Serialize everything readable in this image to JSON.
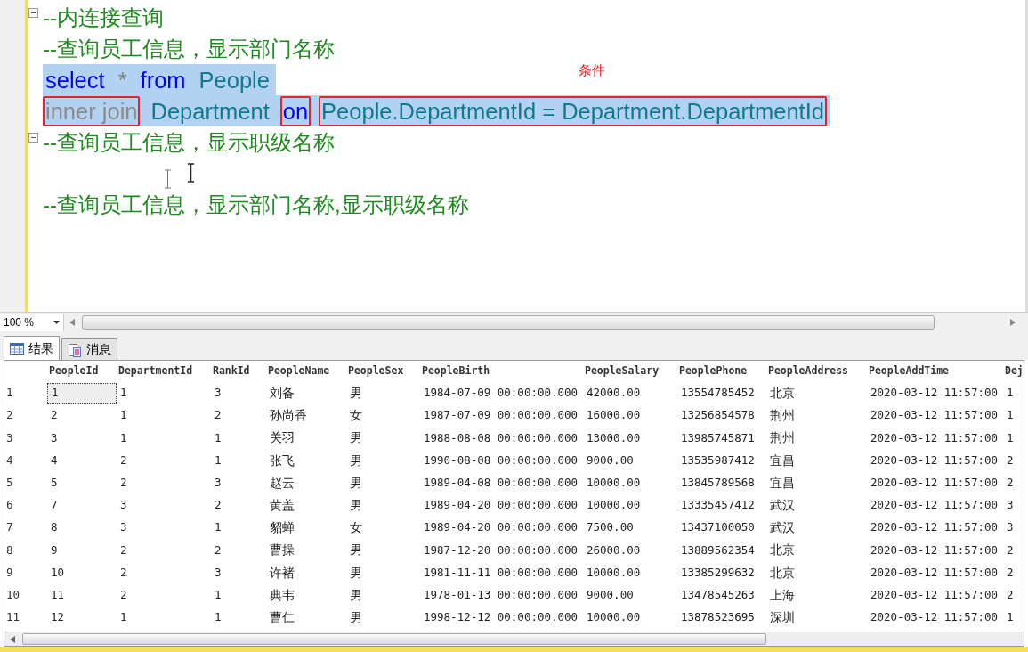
{
  "editor": {
    "lines": [
      {
        "kind": "comment",
        "collapsible": true,
        "selected": false,
        "text": "--内连接查询"
      },
      {
        "kind": "comment",
        "collapsible": false,
        "selected": false,
        "text": "--查询员工信息，显示部门名称"
      },
      {
        "kind": "code",
        "collapsible": false,
        "selected": true,
        "tokens": [
          {
            "kind": "keyword",
            "text": "select",
            "boxed": false
          },
          {
            "kind": "operator",
            "text": "*",
            "boxed": false
          },
          {
            "kind": "keyword",
            "text": "from",
            "boxed": false
          },
          {
            "kind": "identifier",
            "text": "People",
            "boxed": false
          }
        ]
      },
      {
        "kind": "code",
        "collapsible": false,
        "selected": true,
        "tokens": [
          {
            "kind": "join",
            "text": "inner join",
            "boxed": true
          },
          {
            "kind": "identifier",
            "text": "Department",
            "boxed": false
          },
          {
            "kind": "keyword",
            "text": "on",
            "boxed": true
          },
          {
            "kind": "identifier",
            "text": "People.DepartmentId = Department.DepartmentId",
            "boxed": true
          }
        ]
      },
      {
        "kind": "comment",
        "collapsible": true,
        "selected": false,
        "text": "--查询员工信息，显示职级名称"
      },
      {
        "kind": "blank"
      },
      {
        "kind": "comment",
        "collapsible": false,
        "selected": false,
        "text": "--查询员工信息，显示部门名称,显示职级名称"
      }
    ],
    "annotation": "条件"
  },
  "zoom": {
    "value": "100 %"
  },
  "tabs": [
    {
      "label": "结果",
      "selected": true
    },
    {
      "label": "消息",
      "selected": false
    }
  ],
  "grid": {
    "columns": [
      "PeopleId",
      "DepartmentId",
      "RankId",
      "PeopleName",
      "PeopleSex",
      "PeopleBirth",
      "PeopleSalary",
      "PeoplePhone",
      "PeopleAddress",
      "PeopleAddTime",
      "Dej"
    ],
    "rows": [
      {
        "num": "1",
        "selected": true,
        "cells": [
          "1",
          "1",
          "3",
          "刘备",
          "男",
          "1984-07-09 00:00:00.000",
          "42000.00",
          "13554785452",
          "北京",
          "2020-03-12 11:57:00",
          "1"
        ]
      },
      {
        "num": "2",
        "selected": false,
        "cells": [
          "2",
          "1",
          "2",
          "孙尚香",
          "女",
          "1987-07-09 00:00:00.000",
          "16000.00",
          "13256854578",
          "荆州",
          "2020-03-12 11:57:00",
          "1"
        ]
      },
      {
        "num": "3",
        "selected": false,
        "cells": [
          "3",
          "1",
          "1",
          "关羽",
          "男",
          "1988-08-08 00:00:00.000",
          "13000.00",
          "13985745871",
          "荆州",
          "2020-03-12 11:57:00",
          "1"
        ]
      },
      {
        "num": "4",
        "selected": false,
        "cells": [
          "4",
          "2",
          "1",
          "张飞",
          "男",
          "1990-08-08 00:00:00.000",
          "9000.00",
          "13535987412",
          "宜昌",
          "2020-03-12 11:57:00",
          "2"
        ]
      },
      {
        "num": "5",
        "selected": false,
        "cells": [
          "5",
          "2",
          "3",
          "赵云",
          "男",
          "1989-04-08 00:00:00.000",
          "10000.00",
          "13845789568",
          "宜昌",
          "2020-03-12 11:57:00",
          "2"
        ]
      },
      {
        "num": "6",
        "selected": false,
        "cells": [
          "7",
          "3",
          "2",
          "黄盖",
          "男",
          "1989-04-20 00:00:00.000",
          "10000.00",
          "13335457412",
          "武汉",
          "2020-03-12 11:57:00",
          "3"
        ]
      },
      {
        "num": "7",
        "selected": false,
        "cells": [
          "8",
          "3",
          "1",
          "貂蝉",
          "女",
          "1989-04-20 00:00:00.000",
          "7500.00",
          "13437100050",
          "武汉",
          "2020-03-12 11:57:00",
          "3"
        ]
      },
      {
        "num": "8",
        "selected": false,
        "cells": [
          "9",
          "2",
          "2",
          "曹操",
          "男",
          "1987-12-20 00:00:00.000",
          "26000.00",
          "13889562354",
          "北京",
          "2020-03-12 11:57:00",
          "2"
        ]
      },
      {
        "num": "9",
        "selected": false,
        "cells": [
          "10",
          "2",
          "3",
          "许褚",
          "男",
          "1981-11-11 00:00:00.000",
          "10000.00",
          "13385299632",
          "北京",
          "2020-03-12 11:57:00",
          "2"
        ]
      },
      {
        "num": "10",
        "selected": false,
        "cells": [
          "11",
          "2",
          "1",
          "典韦",
          "男",
          "1978-01-13 00:00:00.000",
          "9000.00",
          "13478545263",
          "上海",
          "2020-03-12 11:57:00",
          "2"
        ]
      },
      {
        "num": "11",
        "selected": false,
        "cells": [
          "12",
          "1",
          "1",
          "曹仁",
          "男",
          "1998-12-12 00:00:00.000",
          "10000.00",
          "13878523695",
          "深圳",
          "2020-03-12 11:57:00",
          "1"
        ]
      }
    ]
  }
}
